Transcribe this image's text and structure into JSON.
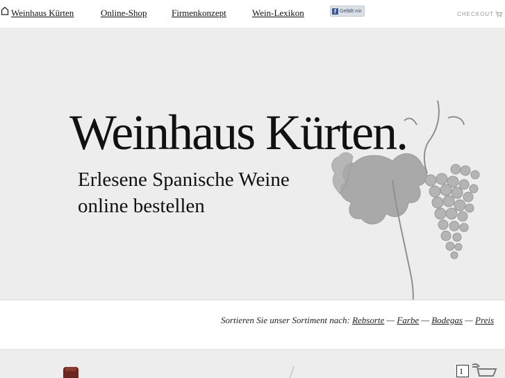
{
  "nav": {
    "home_label": "Weinhaus Kürten",
    "shop_label": "Online-Shop",
    "concept_label": "Firmenkonzept",
    "lexicon_label": "Wein-Lexikon"
  },
  "facebook": {
    "label": "Gefällt mir"
  },
  "checkout": {
    "label": "CHECKOUT"
  },
  "hero": {
    "title": "Weinhaus Kürten.",
    "tagline_line1": "Erlesene Spanische Weine",
    "tagline_line2": "online bestellen"
  },
  "sort": {
    "prefix": "Sortieren Sie unser Sortiment nach:",
    "options": [
      "Rebsorte",
      "Farbe",
      "Bodegas",
      "Preis"
    ],
    "separator": "—"
  },
  "product": {
    "quantity": "1"
  },
  "colors": {
    "hero_bg": "#ededed",
    "text": "#111111",
    "facebook_blue": "#3b5998"
  }
}
